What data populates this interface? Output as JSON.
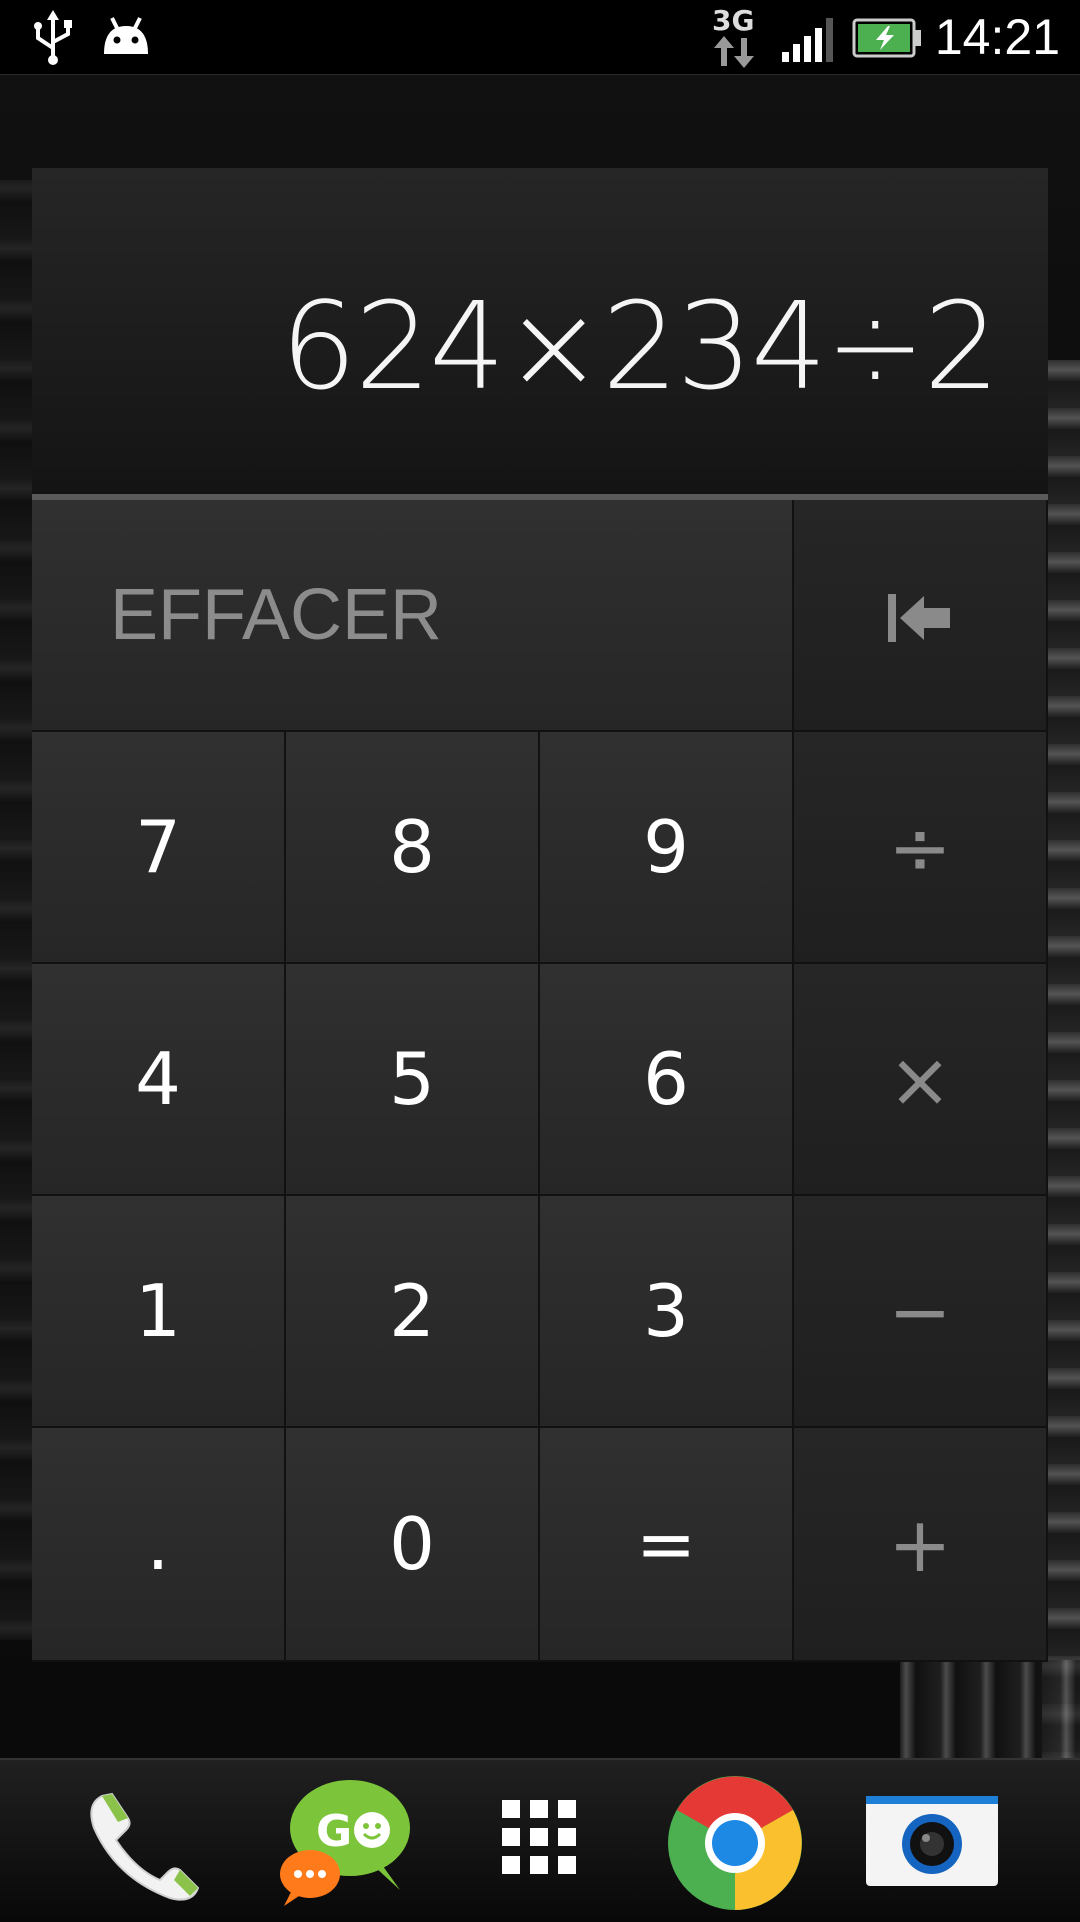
{
  "status_bar": {
    "time": "14:21",
    "network": "3G",
    "icons": [
      "usb-icon",
      "android-debug-icon",
      "data-transfer-icon",
      "signal-icon",
      "battery-charging-icon"
    ]
  },
  "calculator": {
    "display": "624×234÷2",
    "clear_label": "EFFACER",
    "backspace_icon": "backspace-icon",
    "keys": [
      [
        "7",
        "8",
        "9",
        "÷"
      ],
      [
        "4",
        "5",
        "6",
        "×"
      ],
      [
        "1",
        "2",
        "3",
        "−"
      ],
      [
        ".",
        "0",
        "=",
        "+"
      ]
    ]
  },
  "dock": {
    "items": [
      "phone-icon",
      "go-sms-icon",
      "app-drawer-icon",
      "chrome-icon",
      "camera-icon"
    ]
  },
  "colors": {
    "operator_text": "#8a8a8a",
    "digit_text": "#ffffff",
    "battery_green": "#4caf50"
  }
}
